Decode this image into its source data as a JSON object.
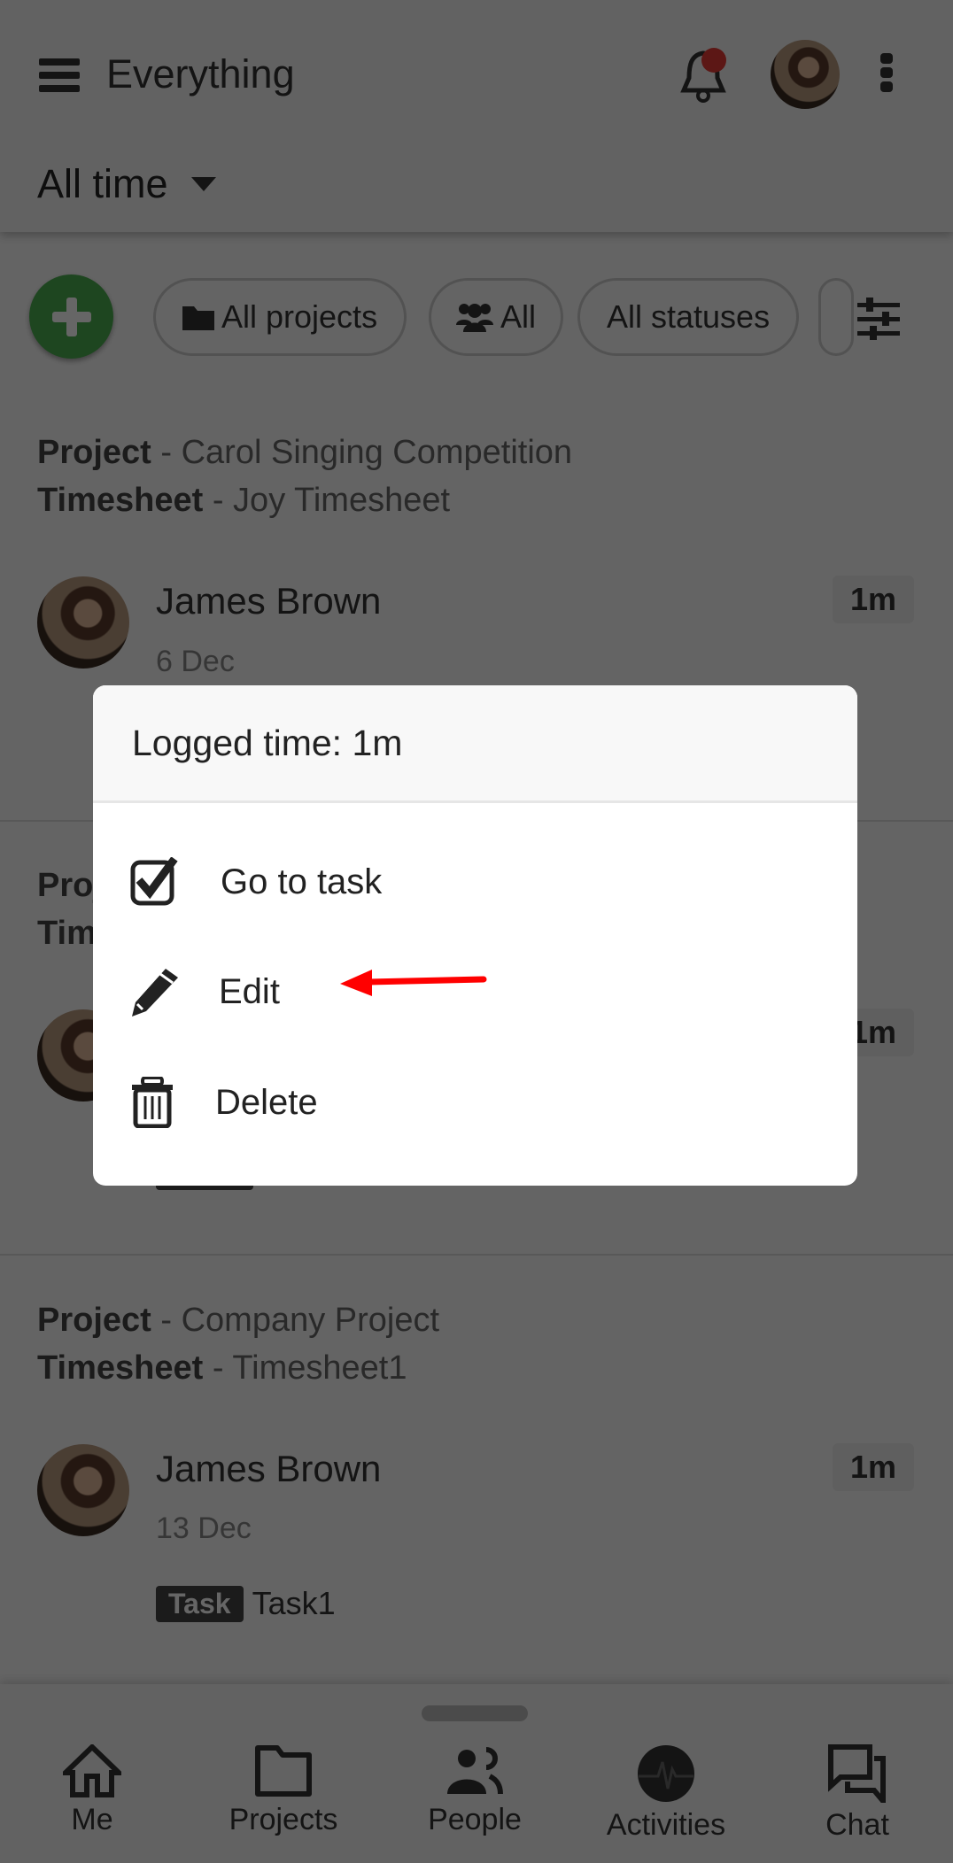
{
  "header": {
    "title": "Everything",
    "menu_icon": "hamburger-icon",
    "notification_icon": "bell-icon",
    "more_icon": "more-vert-icon",
    "period": "All time"
  },
  "filters": {
    "add_icon": "plus-icon",
    "chips": [
      {
        "label": "All projects",
        "icon": "folder-icon"
      },
      {
        "label": "All",
        "icon": "users-icon"
      },
      {
        "label": "All statuses"
      }
    ],
    "settings_icon": "sliders-icon"
  },
  "groups": [
    {
      "project_label": "Project",
      "project": "- Carol Singing Competition",
      "timesheet_label": "Timesheet",
      "timesheet": "- Joy Timesheet",
      "entry": {
        "name": "James Brown",
        "date": "6 Dec",
        "duration": "1m"
      }
    },
    {
      "project_label": "Project",
      "timesheet_label": "Timesheet",
      "entry": {
        "duration": "1m"
      }
    },
    {
      "project_label": "Project",
      "project": "- Company Project",
      "timesheet_label": "Timesheet",
      "timesheet": "- Timesheet1",
      "entry": {
        "name": "James Brown",
        "date": "13 Dec",
        "duration": "1m",
        "task_label": "Task",
        "task": "Task1"
      }
    }
  ],
  "modal": {
    "title": "Logged time: 1m",
    "items": [
      {
        "label": "Go to task",
        "icon": "checkbox-icon"
      },
      {
        "label": "Edit",
        "icon": "pencil-icon"
      },
      {
        "label": "Delete",
        "icon": "trash-icon"
      }
    ]
  },
  "annotation": {
    "color": "#ff0000"
  },
  "nav": [
    {
      "label": "Me",
      "icon": "home-icon"
    },
    {
      "label": "Projects",
      "icon": "folder-icon"
    },
    {
      "label": "People",
      "icon": "people-icon"
    },
    {
      "label": "Activities",
      "icon": "activity-icon"
    },
    {
      "label": "Chat",
      "icon": "chat-icon"
    }
  ],
  "colors": {
    "fab": "#4caf50",
    "notification_dot": "#e53935"
  }
}
